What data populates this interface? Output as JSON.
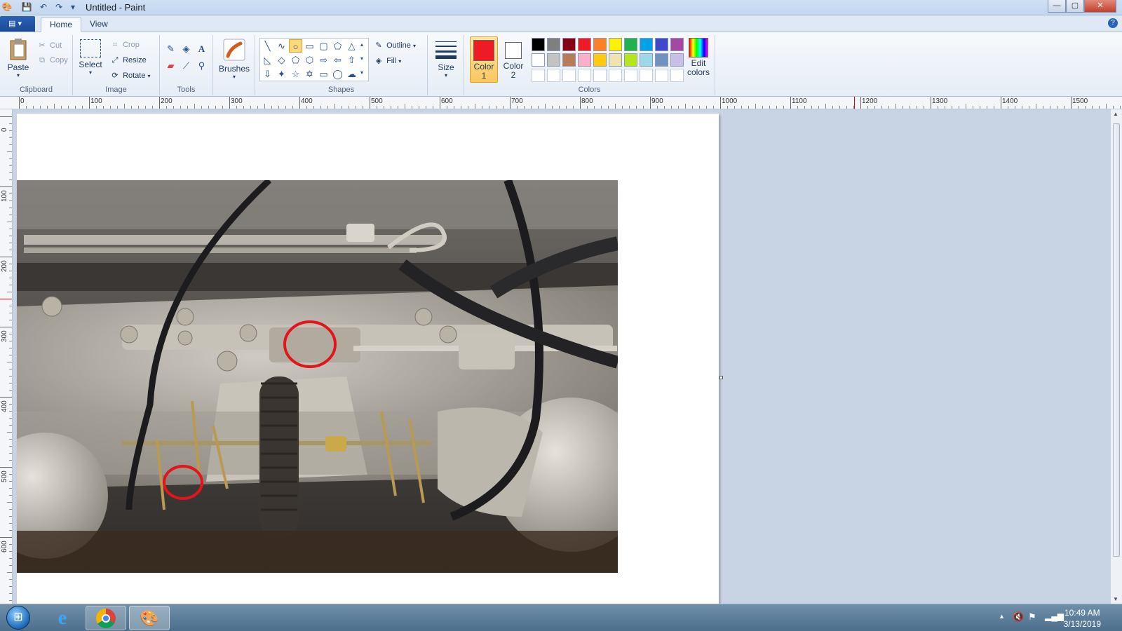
{
  "window": {
    "title": "Untitled - Paint"
  },
  "quick_access": {
    "save_icon": "save-icon",
    "undo_icon": "undo-icon",
    "redo_icon": "redo-icon",
    "dropdown_icon": "dropdown-icon"
  },
  "window_controls": {
    "minimize": "—",
    "restore": "▢",
    "close": "✕"
  },
  "menu": {
    "file_glyph": "▤ ▾",
    "tabs": [
      {
        "label": "Home",
        "active": true
      },
      {
        "label": "View",
        "active": false
      }
    ],
    "help": "?"
  },
  "ribbon": {
    "clipboard": {
      "label": "Clipboard",
      "paste": "Paste",
      "cut": "Cut",
      "copy": "Copy"
    },
    "image": {
      "label": "Image",
      "select": "Select",
      "crop": "Crop",
      "resize": "Resize",
      "rotate": "Rotate"
    },
    "tools": {
      "label": "Tools"
    },
    "brushes": {
      "label": "Brushes"
    },
    "shapes": {
      "label": "Shapes",
      "outline": "Outline",
      "fill": "Fill"
    },
    "size": {
      "label": "Size"
    },
    "color1": {
      "label_1": "Color",
      "label_2": "1",
      "value": "#ed1c24"
    },
    "color2": {
      "label_1": "Color",
      "label_2": "2",
      "value": "#ffffff"
    },
    "colors": {
      "label": "Colors",
      "row1": [
        "#000000",
        "#7f7f7f",
        "#880015",
        "#ed1c24",
        "#ff7f27",
        "#fff200",
        "#22b14c",
        "#00a2e8",
        "#3f48cc",
        "#a349a4"
      ],
      "row2": [
        "#ffffff",
        "#c3c3c3",
        "#b97a57",
        "#ffaec9",
        "#ffc90e",
        "#efe4b0",
        "#b5e61d",
        "#99d9ea",
        "#7092be",
        "#c8bfe7"
      ],
      "row3": [
        "#ffffff",
        "#ffffff",
        "#ffffff",
        "#ffffff",
        "#ffffff",
        "#ffffff",
        "#ffffff",
        "#ffffff",
        "#ffffff",
        "#ffffff"
      ]
    },
    "edit_colors": {
      "line1": "Edit",
      "line2": "colors"
    }
  },
  "ruler": {
    "h_labels": [
      "0",
      "100",
      "200",
      "300",
      "400",
      "500",
      "600",
      "700",
      "800",
      "900",
      "1000",
      "1100",
      "1200",
      "1300",
      "1400",
      "1500"
    ],
    "v_labels": [
      "0",
      "100",
      "200",
      "300",
      "400",
      "500",
      "600"
    ]
  },
  "taskbar": {
    "start": "start-orb-icon",
    "apps": [
      "internet-explorer-icon",
      "chrome-icon",
      "paint-icon"
    ],
    "time": "10:49 AM",
    "date": "3/13/2019"
  }
}
